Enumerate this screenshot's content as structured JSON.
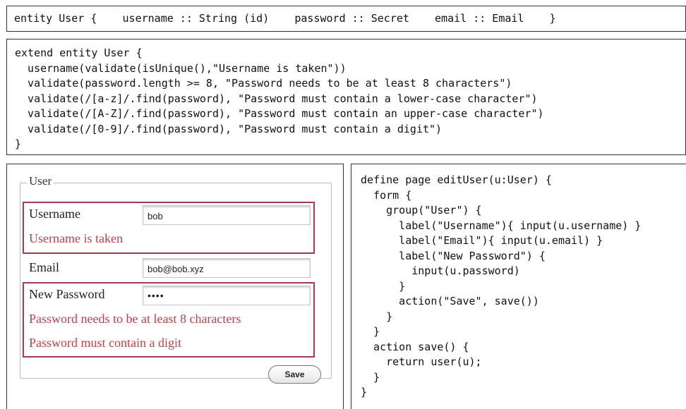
{
  "entity_decl": "entity User {    username :: String (id)    password :: Secret    email :: Email    }",
  "extend_code": [
    "extend entity User {",
    "  username(validate(isUnique(),\"Username is taken\"))",
    "  validate(password.length >= 8, \"Password needs to be at least 8 characters\")",
    "  validate(/[a-z]/.find(password), \"Password must contain a lower-case character\")",
    "  validate(/[A-Z]/.find(password), \"Password must contain an upper-case character\")",
    "  validate(/[0-9]/.find(password), \"Password must contain a digit\")",
    "}"
  ],
  "form": {
    "legend": "User",
    "username_label": "Username",
    "username_value": "bob",
    "username_error": "Username is taken",
    "email_label": "Email",
    "email_value": "bob@bob.xyz",
    "password_label": "New Password",
    "password_value": "••••",
    "password_error_length": "Password needs to be at least 8 characters",
    "password_error_digit": "Password must contain a digit",
    "save_label": "Save"
  },
  "page_code": [
    "define page editUser(u:User) {",
    "  form {",
    "    group(\"User\") {",
    "      label(\"Username\"){ input(u.username) }",
    "      label(\"Email\"){ input(u.email) }",
    "      label(\"New Password\") {",
    "        input(u.password)",
    "      }",
    "      action(\"Save\", save())",
    "    }",
    "  }",
    "  action save() {",
    "    return user(u);",
    "  }",
    "}"
  ],
  "colors": {
    "error_border": "#a33a55",
    "error_text": "#c0404a"
  }
}
